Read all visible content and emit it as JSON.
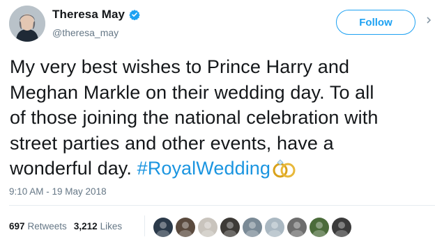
{
  "author": {
    "display_name": "Theresa May",
    "handle": "@theresa_may",
    "verified": true
  },
  "follow_label": "Follow",
  "tweet": {
    "lines": [
      "My very best wishes to Prince Harry and",
      "Meghan Markle on their wedding day. To all",
      "of those joining the national celebration with",
      "street parties and other events, have a"
    ],
    "last_line_text": "wonderful day. ",
    "hashtag": "#RoyalWedding",
    "emoji": "wedding-rings-icon"
  },
  "timestamp": "9:10 AM - 19 May 2018",
  "stats": {
    "retweets_count": "697",
    "retweets_label": "Retweets",
    "likes_count": "3,212",
    "likes_label": "Likes"
  },
  "colors": {
    "accent": "#1da1f2",
    "hashtag": "#1b95e0",
    "muted": "#657786"
  },
  "liker_avatars": [
    {
      "name": "liker-avatar-1",
      "color": "#2b3a4a"
    },
    {
      "name": "liker-avatar-2",
      "color": "#5a4a3e"
    },
    {
      "name": "liker-avatar-3",
      "color": "#c9c4bd"
    },
    {
      "name": "liker-avatar-4",
      "color": "#3d3a36"
    },
    {
      "name": "liker-avatar-5",
      "color": "#7a8a96"
    },
    {
      "name": "liker-avatar-6",
      "color": "#aab8c2"
    },
    {
      "name": "liker-avatar-7",
      "color": "#6d6d6d"
    },
    {
      "name": "liker-avatar-8",
      "color": "#4b6b3a"
    },
    {
      "name": "liker-avatar-9",
      "color": "#3b3b3b"
    }
  ]
}
